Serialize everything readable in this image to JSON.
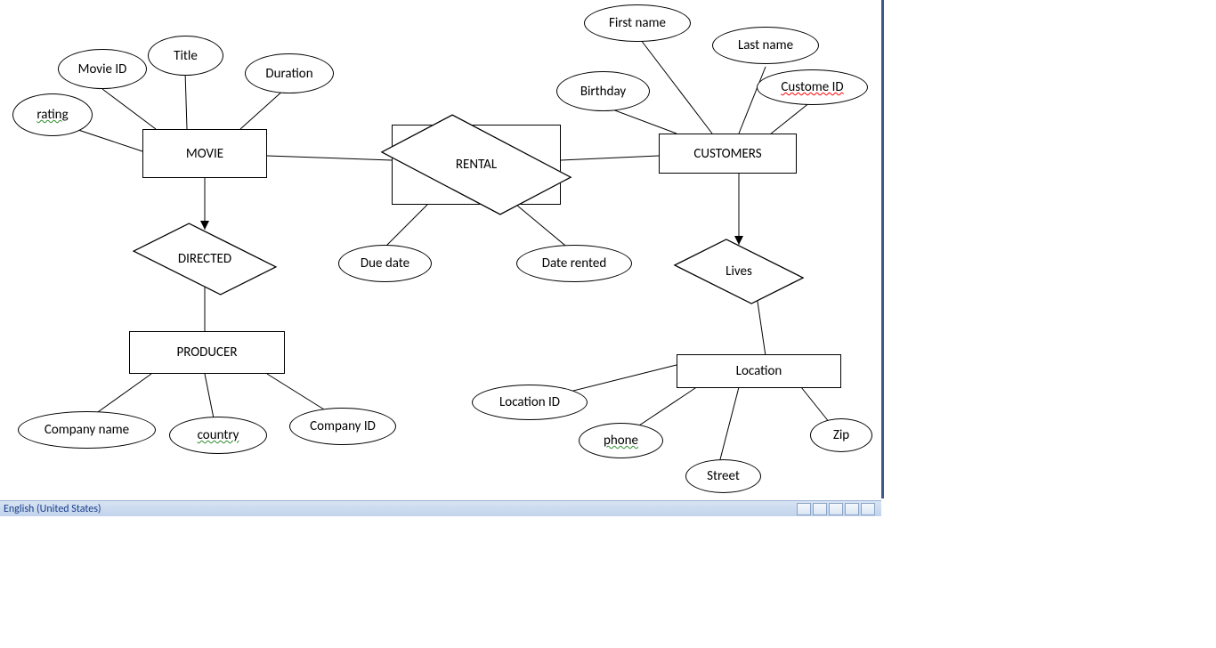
{
  "statusbar": {
    "language": "English (United States)"
  },
  "entities": {
    "movie": "MOVIE",
    "customers": "CUSTOMERS",
    "producer": "PRODUCER",
    "location": "Location"
  },
  "relationships": {
    "rental": "RENTAL",
    "directed": "DIRECTED",
    "lives": "Lives"
  },
  "attributes": {
    "movie_id": "Movie ID",
    "title": "Title",
    "duration": "Duration",
    "rating": "rating",
    "due_date": "Due date",
    "date_rented": "Date rented",
    "first_name": "First name",
    "last_name": "Last name",
    "birthday": "Birthday",
    "custome_id": "Custome ID",
    "company_name": "Company name",
    "country": "country",
    "company_id": "Company ID",
    "location_id": "Location ID",
    "phone": "phone",
    "street": "Street",
    "zip": "Zip"
  }
}
